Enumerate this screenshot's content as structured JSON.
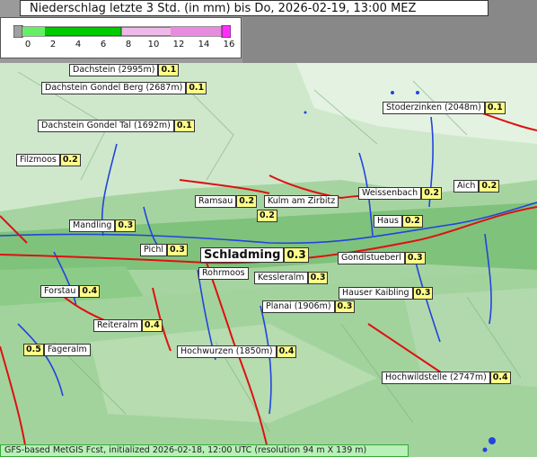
{
  "title": "Niederschlag letzte 3 Std. (in mm) bis Do, 2026-02-19, 13:00 MEZ",
  "legend": {
    "ticks": [
      "0",
      "2",
      "4",
      "6",
      "8",
      "10",
      "12",
      "14",
      "16"
    ],
    "colors": [
      "#a0a0a0",
      "#00dd00",
      "#00b000",
      "#008800",
      "#f0b0e0",
      "#e080d0",
      "#ff40ff"
    ]
  },
  "stations": [
    {
      "name": "Dachstein (2995m)",
      "value": "0.1"
    },
    {
      "name": "Dachstein Gondel Berg (2687m)",
      "value": "0.1"
    },
    {
      "name": "Dachstein Gondel Tal (1692m)",
      "value": "0.1"
    },
    {
      "name": "Stoderzinken (2048m)",
      "value": "0.1"
    },
    {
      "name": "Filzmoos",
      "value": "0.2"
    },
    {
      "name": "Ramsau",
      "value": "0.2"
    },
    {
      "name": "Kulm am Zirbitz",
      "value": "0.2"
    },
    {
      "name": "Weissenbach",
      "value": "0.2"
    },
    {
      "name": "Aich",
      "value": "0.2"
    },
    {
      "name": "Mandling",
      "value": "0.3"
    },
    {
      "name": "Haus",
      "value": "0.2"
    },
    {
      "name": "Pichl",
      "value": "0.3"
    },
    {
      "name": "Schladming",
      "value": "0.3"
    },
    {
      "name": "Gondlstueberl",
      "value": "0.3"
    },
    {
      "name": "Rohrmoos",
      "value": ""
    },
    {
      "name": "Kessleralm",
      "value": "0.3"
    },
    {
      "name": "Forstau",
      "value": "0.4"
    },
    {
      "name": "Hauser Kaibling",
      "value": "0.3"
    },
    {
      "name": "Planai (1906m)",
      "value": "0.3"
    },
    {
      "name": "Reiteralm",
      "value": "0.4"
    },
    {
      "name": "Fageralm",
      "value": "0.5"
    },
    {
      "name": "Hochwurzen (1850m)",
      "value": "0.4"
    },
    {
      "name": "Hochwildstelle (2747m)",
      "value": "0.4"
    }
  ],
  "footer": "GFS-based MetGIS Fcst, initialized 2026-02-18, 12:00 UTC  (resolution 94 m X 139 m)"
}
